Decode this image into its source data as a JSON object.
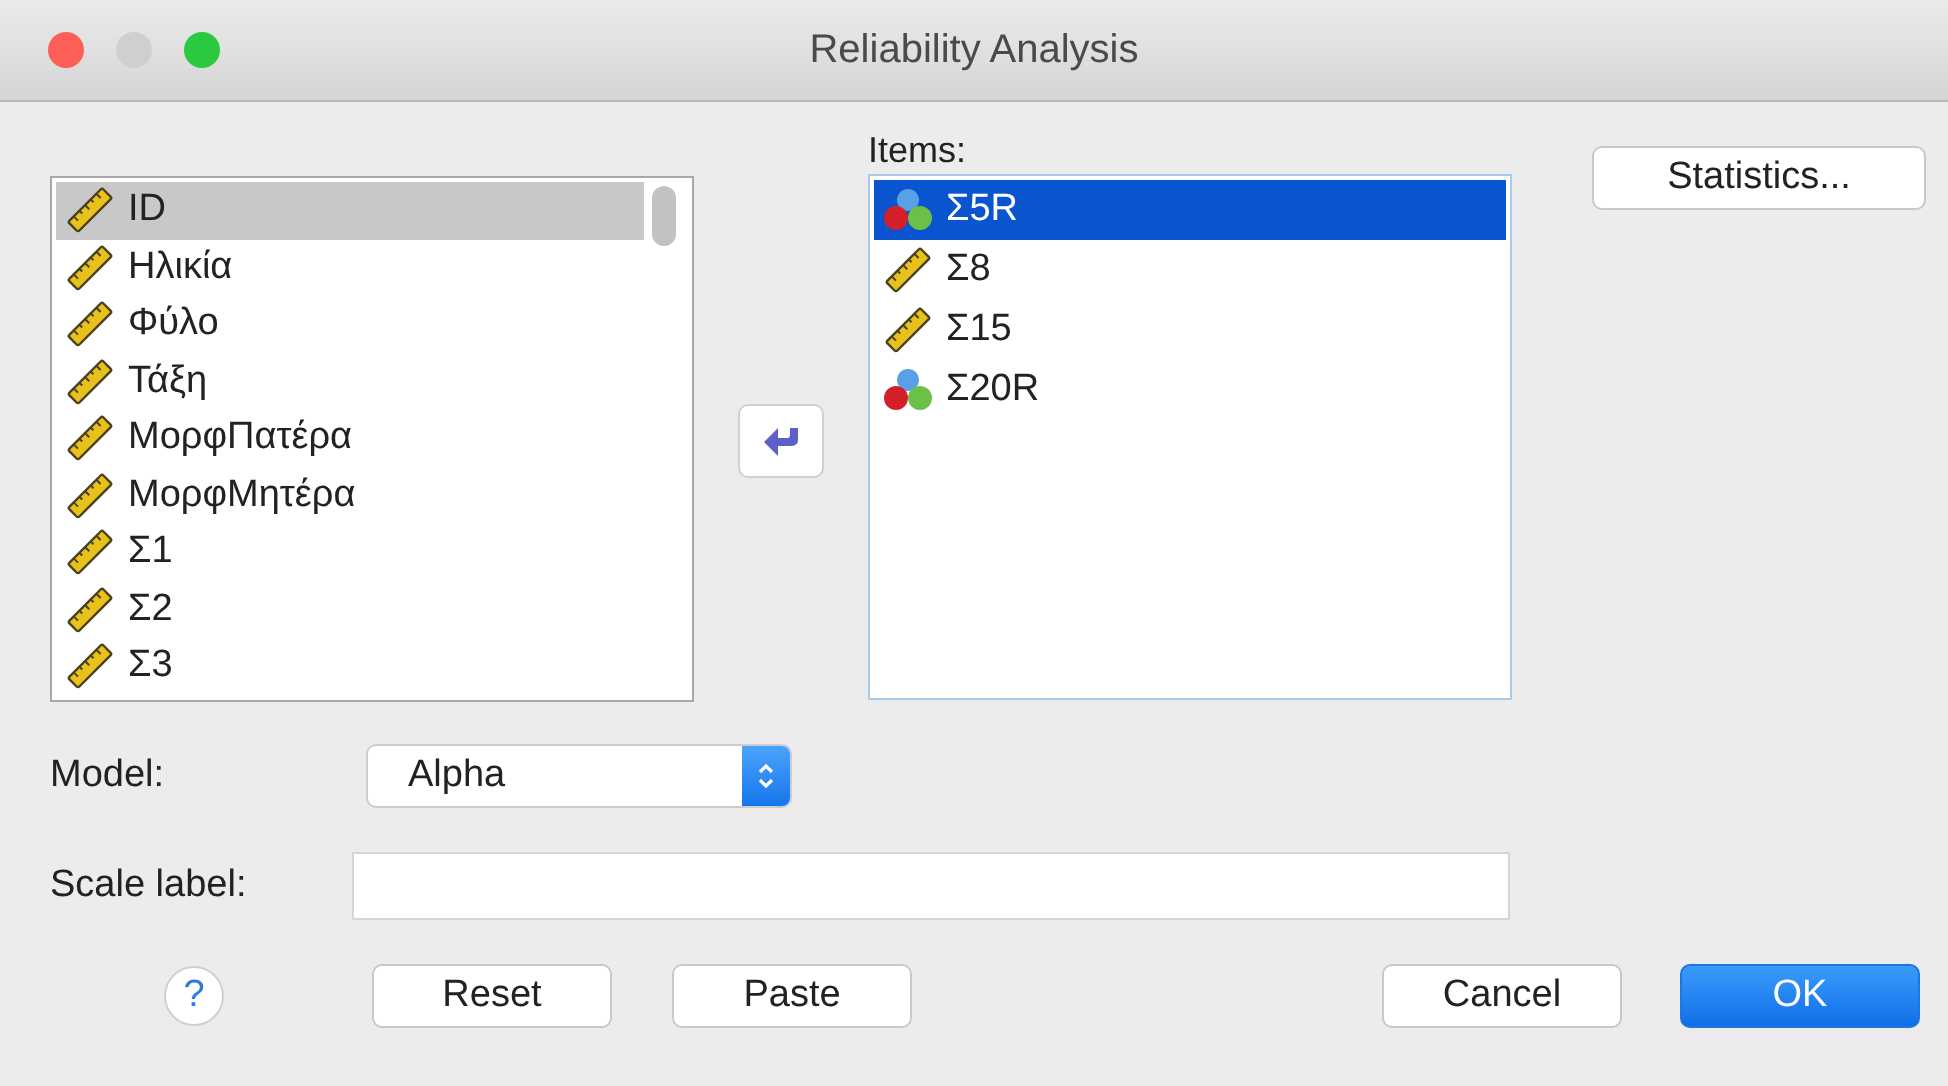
{
  "window": {
    "title": "Reliability Analysis",
    "buttons": [
      {
        "kind": "close",
        "disabled": false
      },
      {
        "kind": "minimize",
        "disabled": true
      },
      {
        "kind": "zoom",
        "disabled": false
      }
    ]
  },
  "variables": [
    {
      "name": "ID",
      "kind": "scale",
      "selected": true
    },
    {
      "name": "Ηλικία",
      "kind": "scale",
      "selected": false
    },
    {
      "name": "Φύλο",
      "kind": "scale",
      "selected": false
    },
    {
      "name": "Τάξη",
      "kind": "scale",
      "selected": false
    },
    {
      "name": "ΜορφΠατέρα",
      "kind": "scale",
      "selected": false
    },
    {
      "name": "ΜορφΜητέρα",
      "kind": "scale",
      "selected": false
    },
    {
      "name": "Σ1",
      "kind": "scale",
      "selected": false
    },
    {
      "name": "Σ2",
      "kind": "scale",
      "selected": false
    },
    {
      "name": "Σ3",
      "kind": "scale",
      "selected": false
    }
  ],
  "items_label": "Items:",
  "items": [
    {
      "name": "Σ5R",
      "kind": "nominal",
      "selected": true
    },
    {
      "name": "Σ8",
      "kind": "scale",
      "selected": false
    },
    {
      "name": "Σ15",
      "kind": "scale",
      "selected": false
    },
    {
      "name": "Σ20R",
      "kind": "nominal",
      "selected": false
    }
  ],
  "statistics_button": "Statistics...",
  "model": {
    "label": "Model:",
    "value": "Alpha"
  },
  "scale_label": {
    "label": "Scale label:"
  },
  "help_button": "?",
  "buttons": [
    {
      "label": "Reset",
      "kind": "normal"
    },
    {
      "label": "Paste",
      "kind": "normal"
    },
    {
      "label": "Cancel",
      "kind": "normal"
    },
    {
      "label": "OK",
      "kind": "default"
    }
  ]
}
